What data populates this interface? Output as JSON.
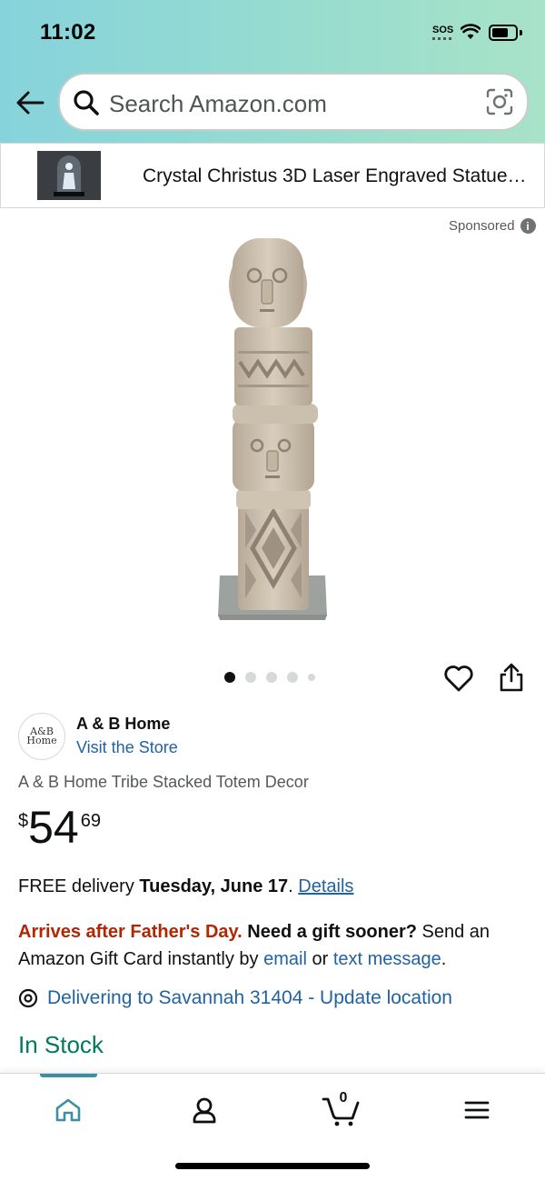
{
  "status_bar": {
    "time": "11:02",
    "sos": "SOS",
    "battery_level": 0.7
  },
  "search": {
    "placeholder": "Search Amazon.com"
  },
  "ad_banner": {
    "title": "Crystal Christus 3D Laser Engraved Statue…"
  },
  "sponsored_label": "Sponsored",
  "carousel": {
    "total_images": 5,
    "active_index": 0
  },
  "brand": {
    "logo_text": "A&B Home",
    "name": "A & B Home",
    "store_link": "Visit the Store"
  },
  "product": {
    "title": "A & B Home Tribe Stacked Totem Decor",
    "price_symbol": "$",
    "price_whole": "54",
    "price_fraction": "69"
  },
  "delivery": {
    "prefix": "FREE delivery ",
    "date": "Tuesday, June 17",
    "suffix": ". ",
    "details_link": "Details"
  },
  "gift": {
    "warning": "Arrives after Father's Day.",
    "question": " Need a gift sooner?",
    "text1": " Send an Amazon Gift Card instantly by ",
    "email_link": "email",
    "text2": " or ",
    "sms_link": "text message",
    "text3": "."
  },
  "location": {
    "text": "Delivering to Savannah 31404 - Update location"
  },
  "stock_status": "In Stock",
  "bottom_nav": {
    "cart_count": "0",
    "active_tab": "home"
  },
  "colors": {
    "link": "#2162a1",
    "in_stock": "#007a5a",
    "warning": "#b12704",
    "header_start": "#86d3dc",
    "header_end": "#a8e3c8",
    "nav_active": "#3a8ea5"
  },
  "icons": [
    "back-arrow-icon",
    "search-icon",
    "camera-icon",
    "info-icon",
    "heart-icon",
    "share-icon",
    "location-pin-icon",
    "home-icon",
    "account-icon",
    "cart-icon",
    "menu-icon"
  ]
}
